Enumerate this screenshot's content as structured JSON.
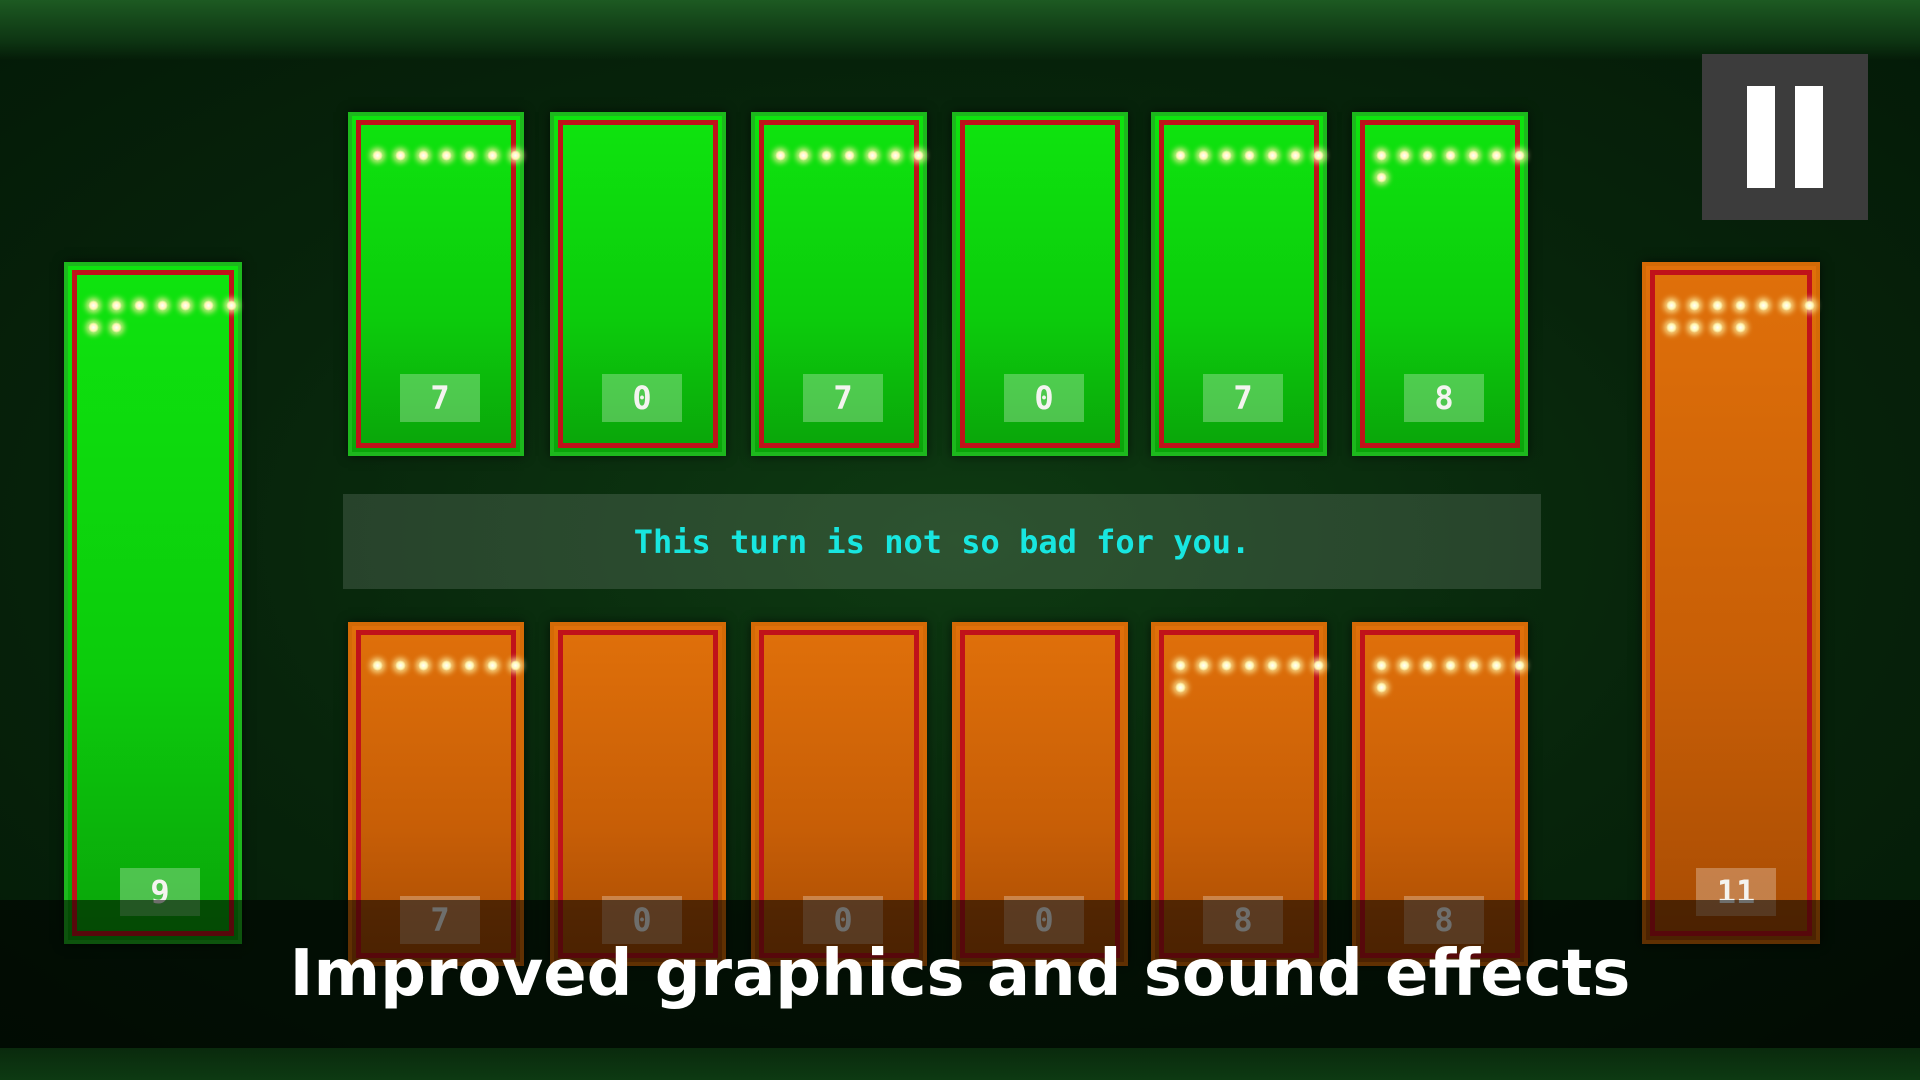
{
  "player_store": {
    "count": "9",
    "seeds": 9,
    "color": "#0ee40e"
  },
  "opponent_store": {
    "count": "11",
    "seeds": 11,
    "color": "#e0700a"
  },
  "top_pits": [
    {
      "count": "7",
      "seeds": 7
    },
    {
      "count": "0",
      "seeds": 0
    },
    {
      "count": "7",
      "seeds": 7
    },
    {
      "count": "0",
      "seeds": 0
    },
    {
      "count": "7",
      "seeds": 7
    },
    {
      "count": "8",
      "seeds": 8
    }
  ],
  "bottom_pits": [
    {
      "count": "7",
      "seeds": 7
    },
    {
      "count": "0",
      "seeds": 0
    },
    {
      "count": "0",
      "seeds": 0
    },
    {
      "count": "0",
      "seeds": 0
    },
    {
      "count": "8",
      "seeds": 8
    },
    {
      "count": "8",
      "seeds": 8
    }
  ],
  "message": "This turn is not so bad for you.",
  "caption": "Improved graphics and sound effects",
  "colors": {
    "accent_text": "#18e6e0",
    "pit_border_red": "#c0121a",
    "green_pit": "#0ee40e",
    "orange_pit": "#e0700a"
  },
  "icons": {
    "pause": "pause-icon",
    "seed": "seed-icon"
  }
}
